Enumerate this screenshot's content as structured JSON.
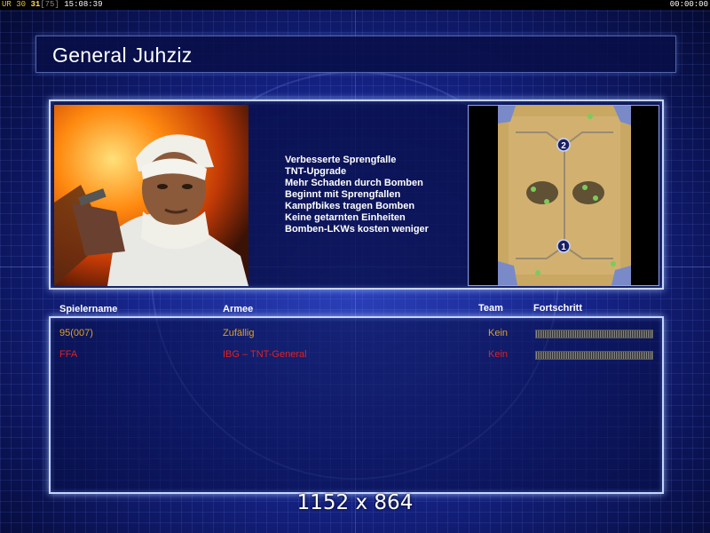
{
  "statusbar": {
    "ur": "UR",
    "n30": "30",
    "n31": "31",
    "bracket": "[75]",
    "clock": "15:08:39",
    "timer": "00:00:00"
  },
  "general": {
    "title": "General Juhziz",
    "traits": [
      "Verbesserte Sprengfalle",
      "TNT-Upgrade",
      "Mehr Schaden durch Bomben",
      "Beginnt mit Sprengfallen",
      "Kampfbikes tragen Bomben",
      "Keine getarnten Einheiten",
      "Bomben-LKWs kosten weniger"
    ]
  },
  "minimap": {
    "start_positions": [
      "2",
      "1"
    ]
  },
  "table": {
    "headers": {
      "name": "Spielername",
      "army": "Armee",
      "team": "Team",
      "progress": "Fortschritt"
    },
    "rows": [
      {
        "name": "95(007)",
        "army": "Zufällig",
        "team": "Kein",
        "progress": 1.0,
        "color": "#e0a020"
      },
      {
        "name": "FFA",
        "army": "IBG – TNT-General",
        "team": "Kein",
        "progress": 1.0,
        "color": "#e02020"
      }
    ]
  },
  "resolution_label": "1152 x 864",
  "colors": {
    "panel_border": "#c8d4ff",
    "background": "#16248a",
    "player1": "#e0a020",
    "player2": "#e02020"
  }
}
